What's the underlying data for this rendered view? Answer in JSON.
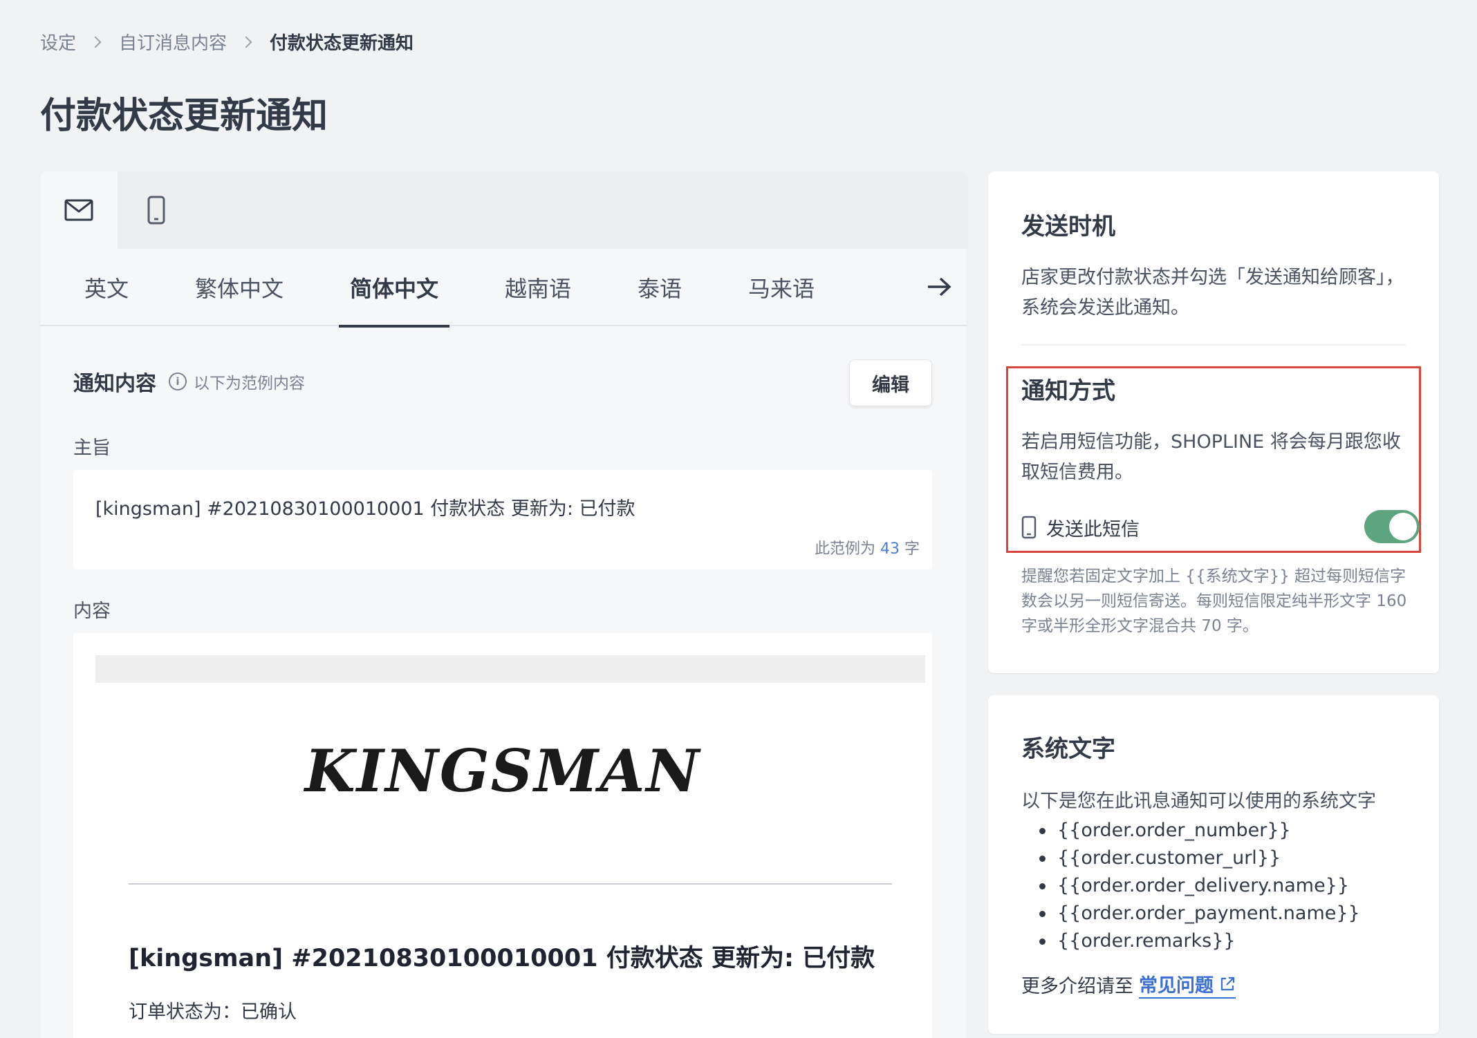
{
  "breadcrumb": {
    "items": [
      "设定",
      "自订消息内容",
      "付款状态更新通知"
    ]
  },
  "page_title": "付款状态更新通知",
  "channel_tabs": {
    "email_icon": "mail-icon",
    "sms_icon": "mobile-phone-icon",
    "active": "email"
  },
  "language_tabs": {
    "items": [
      "英文",
      "繁体中文",
      "简体中文",
      "越南语",
      "泰语",
      "马来语"
    ],
    "active": "简体中文",
    "next_icon": "arrow-right-icon"
  },
  "notification_content": {
    "title": "通知内容",
    "hint": "以下为范例内容",
    "info_icon_glyph": "i",
    "edit_label": "编辑",
    "subject_label": "主旨",
    "subject_text": "[kingsman] #20210830100010001 付款状态 更新为: 已付款",
    "char_count_prefix": "此范例为",
    "char_count_value": "43",
    "char_count_suffix": "字",
    "content_label": "内容",
    "logo_text": "KINGSMAN",
    "email_heading": "[kingsman] #20210830100010001 付款状态 更新为: 已付款",
    "email_line": "订单状态为：已确认"
  },
  "send_timing": {
    "title": "发送时机",
    "description": "店家更改付款状态并勾选「发送通知给顾客」，系统会发送此通知。"
  },
  "notification_method": {
    "title": "通知方式",
    "description": "若启用短信功能，SHOPLINE 将会每月跟您收取短信费用。",
    "sms_toggle_label": "发送此短信",
    "sms_toggle_on": true,
    "note": "提醒您若固定文字加上 {{系统文字}} 超过每则短信字数会以另一则短信寄送。每则短信限定纯半形文字 160 字或半形全形文字混合共 70 字。",
    "highlight_color": "#d8443a",
    "toggle_color": "#5da57f"
  },
  "system_text": {
    "title": "系统文字",
    "intro": "以下是您在此讯息通知可以使用的系统文字",
    "variables": [
      "{{order.order_number}}",
      "{{order.customer_url}}",
      "{{order.order_delivery.name}}",
      "{{order.order_payment.name}}",
      "{{order.remarks}}"
    ],
    "more_prefix": "更多介绍请至",
    "faq_link": "常见问题",
    "link_icon": "external-link-icon"
  }
}
